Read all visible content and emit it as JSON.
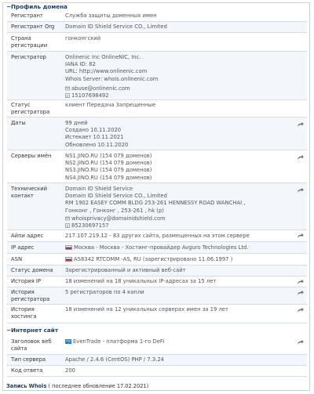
{
  "sections": {
    "domain_profile": "Профиль домена",
    "website": "Интернет сайт"
  },
  "rows": {
    "registrant": {
      "label": "Регистрант",
      "value": "Служба защиты доменных имен"
    },
    "registrant_org": {
      "label": "Регистрант Org",
      "value": "Domain ID Shield Service CO., Limited"
    },
    "country": {
      "label": "Страна регистрации",
      "value": "гонконгский"
    },
    "registrar": {
      "label": "Регистратор",
      "lines": [
        "Onlinenic Inc OnlineNIC, Inc.",
        "IANA ID: 82",
        "URL: http://www.onlinenic.com",
        "Whois Server: whois.onlinenic.com"
      ],
      "email": "abuse@onlinenic.com",
      "phone": "15107698492"
    },
    "registrar_status": {
      "label": "Статус регистратора",
      "value": "клиент Передача Запрещенные"
    },
    "dates": {
      "label": "Даты",
      "lines": [
        "99 дней",
        "Создано 10.11.2020",
        "Истекает 10.11.2021",
        "Обновлено 10.11.2020"
      ]
    },
    "nameservers": {
      "label": "Серверы имён",
      "lines": [
        "NS1.JINO.RU (154 079 доменов)",
        "NS2.JINO.RU (154 079 доменов)",
        "NS3.JINO.RU (154 079 доменов)",
        "NS4.JINO.RU (154 079 доменов)"
      ]
    },
    "tech_contact": {
      "label": "Технический контакт",
      "lines": [
        "Domain ID Shield Service",
        "Domain ID Shield Service CO., Limited",
        "RM 1902 EASEY COMM BLDG 253-261 HENNESSY ROAD WANCHAI ,",
        "Гонконг , Гонконг , 253-261 , hk (p)"
      ],
      "email": "whoisprivacy@domainidshield.com",
      "phone": "85230697157"
    },
    "ip_address": {
      "label": "Айпи адрес",
      "value": "217.107.219.12 - 83 других сайта, размещенных на этом сервере"
    },
    "ip_location": {
      "label": "IP адрес",
      "value": "Москва - Москва - Хостинг-провайдер Avguro Technologies Ltd."
    },
    "asn": {
      "label": "ASN",
      "value": "AS8342 RTCOMM -AS, RU (зарегистрировано 11.06.1997 )"
    },
    "domain_status": {
      "label": "Статус домена",
      "value": "Зарегистрированный и активный веб-сайт"
    },
    "ip_history": {
      "label": "История IP",
      "value": "18 изменений на 18 уникальных IP-адресах за 15 лет"
    },
    "registrar_history": {
      "label": "История регистратора",
      "value": "5 регистраторов по 4 капли"
    },
    "hosting_history": {
      "label": "История хостинга",
      "value": "18 изменений на 12 уникальных серверах имен за 19 лет"
    },
    "site_title": {
      "label": "Заголовок веб сайта",
      "value": "EvenTrade - платформа 1-го DeFi"
    },
    "server_type": {
      "label": "Тип сервера",
      "value": "Apache / 2.4.6 (CentOS) PHP / 7.3.24"
    },
    "response_code": {
      "label": "Код ответа",
      "value": "200"
    }
  },
  "footer": {
    "title": "Запись Whois",
    "note": "( последнее обновление 17.02.2021)"
  },
  "colors": {
    "heading": "#1f3d66",
    "row_alt": "#f3f6fa",
    "border": "#d6dde6"
  }
}
